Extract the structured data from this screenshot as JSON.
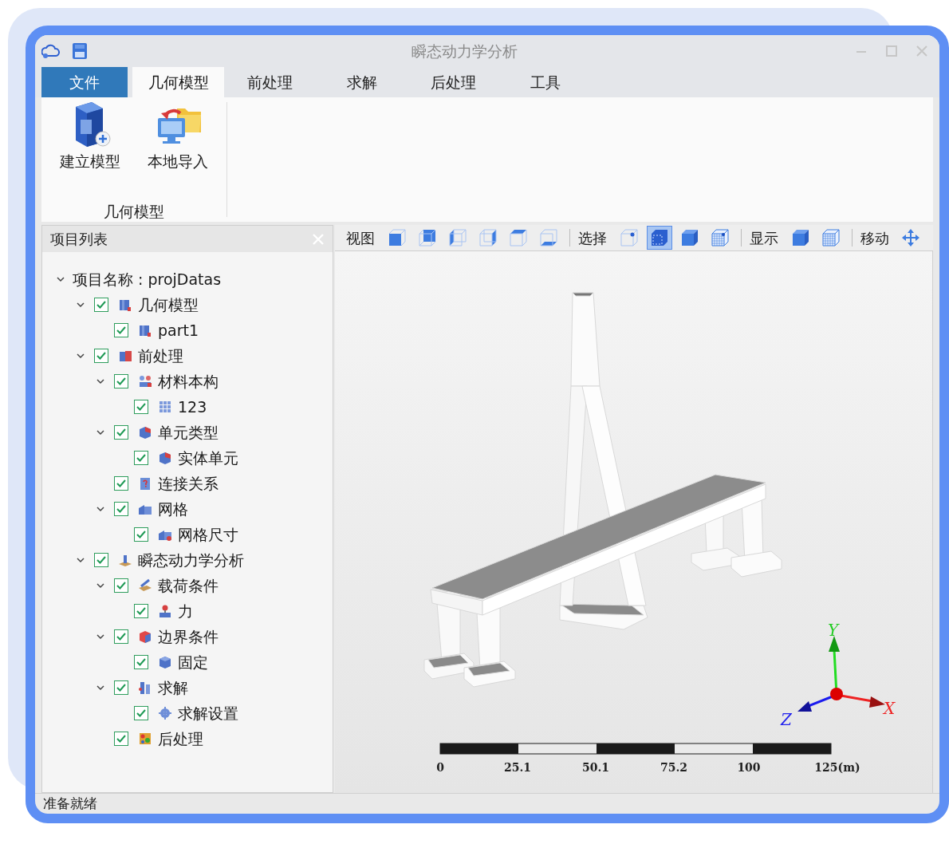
{
  "window": {
    "title": "瞬态动力学分析"
  },
  "tabs": [
    {
      "label": "文件",
      "kind": "file",
      "selected": false
    },
    {
      "label": "几何模型",
      "kind": "tab",
      "selected": true
    },
    {
      "label": "前处理",
      "kind": "tab",
      "selected": false
    },
    {
      "label": "求解",
      "kind": "tab",
      "selected": false
    },
    {
      "label": "后处理",
      "kind": "tab",
      "selected": false
    },
    {
      "label": "工具",
      "kind": "tab",
      "selected": false
    }
  ],
  "ribbon": {
    "buttons": [
      {
        "label": "建立模型",
        "kind": "new-model"
      },
      {
        "label": "本地导入",
        "kind": "import"
      }
    ],
    "group_label": "几何模型"
  },
  "project_panel": {
    "title": "项目列表",
    "tree": {
      "label": "项目名称 : projDatas",
      "expanded": true,
      "children": [
        {
          "label": "几何模型",
          "kind": "geometry",
          "checked": true,
          "expanded": true,
          "children": [
            {
              "label": "part1",
              "kind": "geometry",
              "checked": true
            }
          ]
        },
        {
          "label": "前处理",
          "kind": "preprocess",
          "checked": true,
          "expanded": true,
          "children": [
            {
              "label": "材料本构",
              "kind": "material",
              "checked": true,
              "expanded": true,
              "children": [
                {
                  "label": "123",
                  "kind": "grid",
                  "checked": true
                }
              ]
            },
            {
              "label": "单元类型",
              "kind": "element",
              "checked": true,
              "expanded": true,
              "children": [
                {
                  "label": "实体单元",
                  "kind": "element",
                  "checked": true
                }
              ]
            },
            {
              "label": "连接关系",
              "kind": "connection",
              "checked": true
            },
            {
              "label": "网格",
              "kind": "mesh",
              "checked": true,
              "expanded": true,
              "children": [
                {
                  "label": "网格尺寸",
                  "kind": "mesh-size",
                  "checked": true
                }
              ]
            }
          ]
        },
        {
          "label": "瞬态动力学分析",
          "kind": "analysis",
          "checked": true,
          "expanded": true,
          "children": [
            {
              "label": "载荷条件",
              "kind": "load",
              "checked": true,
              "expanded": true,
              "children": [
                {
                  "label": "力",
                  "kind": "force",
                  "checked": true
                }
              ]
            },
            {
              "label": "边界条件",
              "kind": "boundary",
              "checked": true,
              "expanded": true,
              "children": [
                {
                  "label": "固定",
                  "kind": "fixed",
                  "checked": true
                }
              ]
            },
            {
              "label": "求解",
              "kind": "solve",
              "checked": true,
              "expanded": true,
              "children": [
                {
                  "label": "求解设置",
                  "kind": "solve-settings",
                  "checked": true
                }
              ]
            },
            {
              "label": "后处理",
              "kind": "postprocess",
              "checked": true
            }
          ]
        }
      ]
    }
  },
  "view_toolbar": [
    {
      "label": "视图",
      "tools": [
        {
          "kind": "face-front",
          "selected": false
        },
        {
          "kind": "face-back",
          "selected": false
        },
        {
          "kind": "face-left",
          "selected": false
        },
        {
          "kind": "face-right",
          "selected": false
        },
        {
          "kind": "face-top",
          "selected": false
        },
        {
          "kind": "face-bottom",
          "selected": false
        }
      ]
    },
    {
      "label": "选择",
      "tools": [
        {
          "kind": "pick-point",
          "selected": false
        },
        {
          "kind": "pick-cell",
          "selected": true
        },
        {
          "kind": "solid",
          "selected": false
        },
        {
          "kind": "mesh-point",
          "selected": false
        }
      ]
    },
    {
      "label": "显示",
      "tools": [
        {
          "kind": "solid",
          "selected": false
        },
        {
          "kind": "mesh",
          "selected": false
        }
      ]
    },
    {
      "label": "移动",
      "tools": [
        {
          "kind": "move",
          "selected": false
        }
      ]
    }
  ],
  "viewport": {
    "axes": {
      "x": "X",
      "y": "Y",
      "z": "Z"
    },
    "scale_labels": [
      "0",
      "25.1",
      "50.1",
      "75.2",
      "100",
      "125(m)"
    ]
  },
  "status_bar": "准备就绪"
}
